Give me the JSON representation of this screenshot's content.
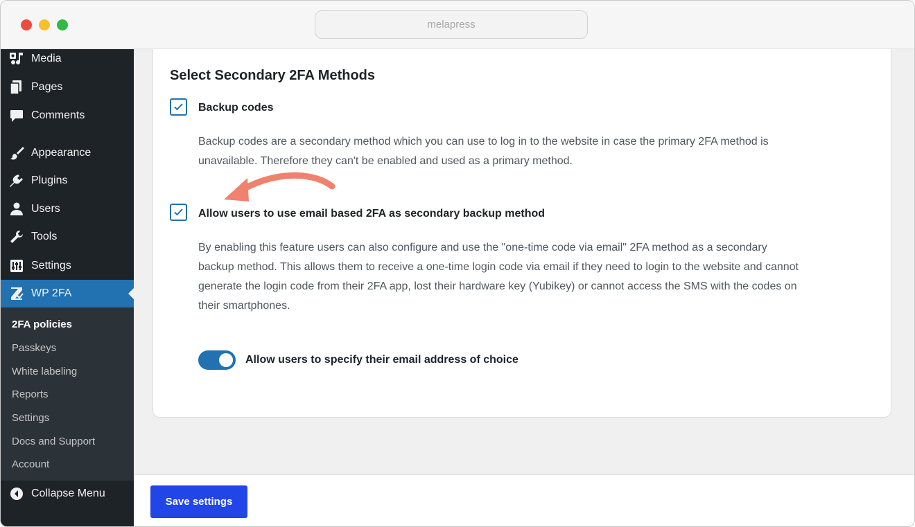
{
  "browser": {
    "url_text": "melapress"
  },
  "sidebar": {
    "items": [
      {
        "label": "Media",
        "icon": "media-icon"
      },
      {
        "label": "Pages",
        "icon": "pages-icon"
      },
      {
        "label": "Comments",
        "icon": "comments-icon"
      },
      {
        "label": "Appearance",
        "icon": "appearance-icon"
      },
      {
        "label": "Plugins",
        "icon": "plugins-icon"
      },
      {
        "label": "Users",
        "icon": "users-icon"
      },
      {
        "label": "Tools",
        "icon": "tools-icon"
      },
      {
        "label": "Settings",
        "icon": "settings-icon"
      },
      {
        "label": "WP 2FA",
        "icon": "wp2fa-icon",
        "active": true
      }
    ],
    "submenu": [
      "2FA policies",
      "Passkeys",
      "White labeling",
      "Reports",
      "Settings",
      "Docs and Support",
      "Account"
    ],
    "current_submenu": "2FA policies",
    "collapse_label": "Collapse Menu"
  },
  "main": {
    "heading": "Select Secondary 2FA Methods",
    "backup_codes": {
      "label": "Backup codes",
      "checked": true,
      "desc_line1": "Backup codes are a secondary method which you can use to log in to the website in case the primary 2FA method is",
      "desc_line2": "unavailable. Therefore they can't be enabled and used as a primary method."
    },
    "email_backup": {
      "label": "Allow users to use email based 2FA as secondary backup method",
      "checked": true,
      "desc_line1": "By enabling this feature users can also configure and use the \"one-time code via email\" 2FA method as a secondary",
      "desc_line2": "backup method. This allows them to receive a one-time login code via email if they need to login to the website and cannot",
      "desc_line3": "generate the login code from their 2FA app, lost their hardware key (Yubikey) or cannot access the SMS with the codes on",
      "desc_line4": "their smartphones."
    },
    "email_choice_toggle": {
      "label": "Allow users to specify their email address of choice",
      "on": true
    }
  },
  "footer": {
    "save_label": "Save settings"
  },
  "colors": {
    "accent": "#2271b1",
    "save_button": "#2145e6",
    "arrow": "#f0826d",
    "sidebar_bg": "#1d2327"
  }
}
